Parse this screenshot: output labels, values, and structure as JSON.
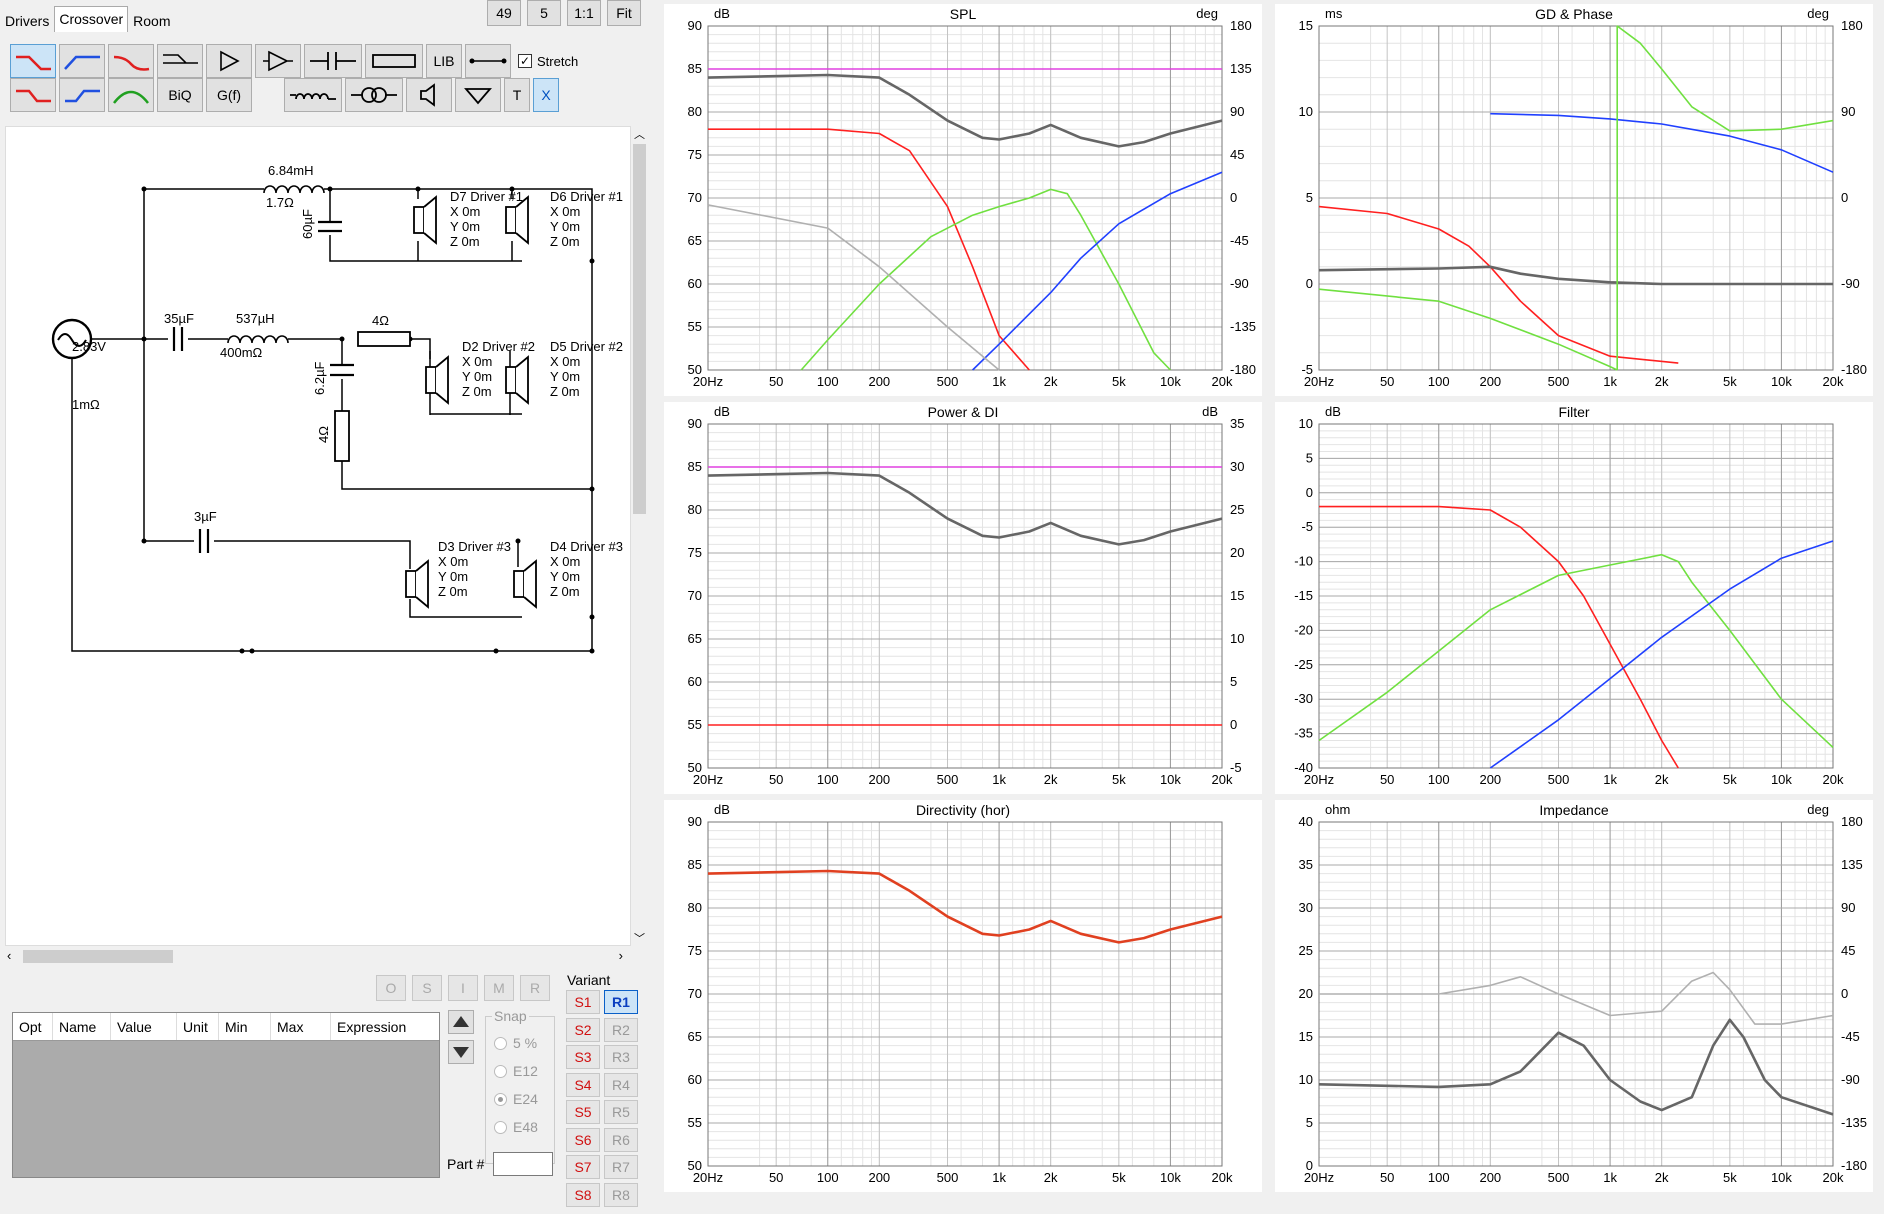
{
  "tabs": [
    {
      "label": "Drivers"
    },
    {
      "label": "Crossover"
    },
    {
      "label": "Room"
    }
  ],
  "top_buttons": {
    "b1": "49",
    "b2": "5",
    "b3": "1:1",
    "b4": "Fit"
  },
  "toolbar": {
    "lib": "LIB",
    "stretch": "Stretch",
    "biq": "BiQ",
    "gf": "G(f)",
    "t": "T",
    "x": "X"
  },
  "schematic": {
    "source_voltage": "2.83V",
    "source_res": "1mΩ",
    "l1": "6.84mH",
    "l1_res": "1.7Ω",
    "c1": "60µF",
    "c2": "35µF",
    "l2": "537µH",
    "l2_res": "400mΩ",
    "r1": "4Ω",
    "c3": "6.2µF",
    "r2": "4Ω",
    "c4": "3µF",
    "drivers": [
      {
        "name": "D7 Driver #1",
        "x": "X 0m",
        "y": "Y 0m",
        "z": "Z 0m"
      },
      {
        "name": "D6 Driver #1",
        "x": "X 0m",
        "y": "Y 0m",
        "z": "Z 0m"
      },
      {
        "name": "D2 Driver #2",
        "x": "X 0m",
        "y": "Y 0m",
        "z": "Z 0m"
      },
      {
        "name": "D5 Driver #2",
        "x": "X 0m",
        "y": "Y 0m",
        "z": "Z 0m"
      },
      {
        "name": "D3 Driver #3",
        "x": "X 0m",
        "y": "Y 0m",
        "z": "Z 0m"
      },
      {
        "name": "D4 Driver #3",
        "x": "X 0m",
        "y": "Y 0m",
        "z": "Z 0m"
      }
    ]
  },
  "optimizer": {
    "buttons": [
      "O",
      "S",
      "I",
      "M",
      "R"
    ],
    "columns": [
      "Opt",
      "Name",
      "Value",
      "Unit",
      "Min",
      "Max",
      "Expression"
    ]
  },
  "snap": {
    "label": "Snap",
    "options": [
      "5 %",
      "E12",
      "E24",
      "E48"
    ],
    "selected": "E24"
  },
  "part_label": "Part #",
  "variant": {
    "label": "Variant",
    "s": [
      "S1",
      "S2",
      "S3",
      "S4",
      "S5",
      "S6",
      "S7",
      "S8"
    ],
    "r": [
      "R1",
      "R2",
      "R3",
      "R4",
      "R5",
      "R6",
      "R7",
      "R8"
    ]
  },
  "colors": {
    "red": "#ff2020",
    "blue": "#2040ff",
    "green": "#70e040",
    "gray": "#666666",
    "lightgray": "#b0b0b0",
    "magenta": "#e040e0",
    "orange": "#e04020"
  },
  "plots": [
    {
      "title": "SPL",
      "lunit": "dB",
      "runit": "deg",
      "ylim": [
        50,
        90
      ],
      "yticks": [
        "90",
        "85",
        "80",
        "75",
        "70",
        "65",
        "60",
        "55",
        "50"
      ],
      "rticks": [
        "180",
        "135",
        "90",
        "45",
        "0",
        "-45",
        "-90",
        "-135",
        "-180"
      ]
    },
    {
      "title": "GD & Phase",
      "lunit": "ms",
      "runit": "deg",
      "ylim": [
        -5,
        15
      ],
      "yticks": [
        "15",
        "10",
        "5",
        "0",
        "-5"
      ],
      "rticks": [
        "180",
        "90",
        "0",
        "-90",
        "-180"
      ]
    },
    {
      "title": "Power & DI",
      "lunit": "dB",
      "runit": "dB",
      "ylim": [
        50,
        90
      ],
      "yticks": [
        "90",
        "85",
        "80",
        "75",
        "70",
        "65",
        "60",
        "55",
        "50"
      ],
      "rticks": [
        "35",
        "30",
        "25",
        "20",
        "15",
        "10",
        "5",
        "0",
        "-5"
      ]
    },
    {
      "title": "Filter",
      "lunit": "dB",
      "runit": "",
      "ylim": [
        -40,
        10
      ],
      "yticks": [
        "10",
        "5",
        "0",
        "-5",
        "-10",
        "-15",
        "-20",
        "-25",
        "-30",
        "-35",
        "-40"
      ],
      "rticks": []
    },
    {
      "title": "Directivity (hor)",
      "lunit": "dB",
      "runit": "",
      "ylim": [
        50,
        90
      ],
      "yticks": [
        "90",
        "85",
        "80",
        "75",
        "70",
        "65",
        "60",
        "55",
        "50"
      ],
      "rticks": []
    },
    {
      "title": "Impedance",
      "lunit": "ohm",
      "runit": "deg",
      "ylim": [
        0,
        40
      ],
      "yticks": [
        "40",
        "35",
        "30",
        "25",
        "20",
        "15",
        "10",
        "5",
        "0"
      ],
      "rticks": [
        "180",
        "135",
        "90",
        "45",
        "0",
        "-45",
        "-90",
        "-135",
        "-180"
      ]
    }
  ],
  "xticks": [
    "20Hz",
    "50",
    "100",
    "200",
    "500",
    "1k",
    "2k",
    "5k",
    "10k",
    "20k"
  ],
  "chart_data": [
    {
      "type": "line",
      "title": "SPL",
      "ylabel": "dB",
      "xlim": [
        20,
        20000
      ],
      "ylim": [
        50,
        90
      ],
      "xscale": "log",
      "series": [
        {
          "color": "magenta",
          "x": [
            20,
            20000
          ],
          "y": [
            85,
            85
          ]
        },
        {
          "color": "gray",
          "x": [
            20,
            100,
            200,
            300,
            500,
            800,
            1000,
            1500,
            2000,
            3000,
            5000,
            7000,
            10000,
            20000
          ],
          "y": [
            84,
            84.3,
            84,
            82,
            79,
            77,
            76.8,
            77.5,
            78.5,
            77,
            76,
            76.5,
            77.5,
            79
          ]
        },
        {
          "color": "red",
          "x": [
            20,
            100,
            200,
            300,
            500,
            700,
            1000,
            1500
          ],
          "y": [
            78,
            78,
            77.5,
            75.5,
            69,
            62,
            54,
            50
          ]
        },
        {
          "color": "green",
          "x": [
            70,
            100,
            200,
            400,
            700,
            1000,
            1500,
            2000,
            2500,
            3000,
            5000,
            8000,
            10000
          ],
          "y": [
            50,
            53.5,
            60,
            65.5,
            68,
            69,
            70,
            71,
            70.5,
            68,
            60,
            52,
            50
          ]
        },
        {
          "color": "blue",
          "x": [
            700,
            1000,
            2000,
            3000,
            5000,
            10000,
            20000
          ],
          "y": [
            50,
            53,
            59,
            63,
            67,
            70.5,
            73
          ]
        },
        {
          "color": "lightgray",
          "x": [
            20,
            100,
            200,
            500,
            1000
          ],
          "y": [
            69.2,
            66.5,
            62,
            55,
            50
          ]
        }
      ]
    },
    {
      "type": "line",
      "title": "GD & Phase",
      "ylabel": "ms",
      "xlim": [
        20,
        20000
      ],
      "ylim": [
        -5,
        15
      ],
      "xscale": "log",
      "series": [
        {
          "color": "red",
          "x": [
            20,
            50,
            100,
            150,
            200,
            300,
            500,
            1000,
            2500
          ],
          "y": [
            4.5,
            4.1,
            3.2,
            2.2,
            1,
            -1,
            -3,
            -4.2,
            -4.6
          ]
        },
        {
          "color": "gray",
          "x": [
            20,
            100,
            200,
            300,
            500,
            1000,
            2000,
            20000
          ],
          "y": [
            0.8,
            0.9,
            1,
            0.6,
            0.3,
            0.1,
            0,
            0
          ]
        },
        {
          "color": "green",
          "x": [
            20,
            100,
            200,
            500,
            1000,
            1100
          ],
          "y": [
            -0.3,
            -1,
            -2,
            -3.5,
            -4.8,
            -5
          ]
        },
        {
          "color": "blue",
          "x": [
            200,
            500,
            1000,
            2000,
            5000,
            10000,
            20000
          ],
          "y": [
            9.9,
            9.8,
            9.6,
            9.3,
            8.6,
            7.8,
            6.5
          ]
        },
        {
          "color": "green",
          "x": [
            1100,
            1100,
            1500,
            2000,
            3000,
            5000,
            10000,
            20000
          ],
          "y": [
            -5,
            15,
            14,
            12.5,
            10.3,
            8.9,
            9,
            9.5
          ]
        }
      ]
    },
    {
      "type": "line",
      "title": "Power & DI",
      "ylabel": "dB",
      "xlim": [
        20,
        20000
      ],
      "ylim": [
        50,
        90
      ],
      "xscale": "log",
      "series": [
        {
          "color": "magenta",
          "x": [
            20,
            20000
          ],
          "y": [
            85,
            85
          ]
        },
        {
          "color": "gray",
          "x": [
            20,
            100,
            200,
            300,
            500,
            800,
            1000,
            1500,
            2000,
            3000,
            5000,
            7000,
            10000,
            20000
          ],
          "y": [
            84,
            84.3,
            84,
            82,
            79,
            77,
            76.8,
            77.5,
            78.5,
            77,
            76,
            76.5,
            77.5,
            79
          ]
        },
        {
          "color": "red",
          "x": [
            20,
            20000
          ],
          "y": [
            55,
            55
          ]
        }
      ]
    },
    {
      "type": "line",
      "title": "Filter",
      "ylabel": "dB",
      "xlim": [
        20,
        20000
      ],
      "ylim": [
        -40,
        10
      ],
      "xscale": "log",
      "series": [
        {
          "color": "red",
          "x": [
            20,
            100,
            200,
            300,
            500,
            700,
            1000,
            1500,
            2000,
            2500
          ],
          "y": [
            -2,
            -2,
            -2.5,
            -5,
            -10,
            -15,
            -22,
            -30,
            -36,
            -40
          ]
        },
        {
          "color": "green",
          "x": [
            20,
            50,
            100,
            200,
            500,
            1000,
            2000,
            2500,
            3000,
            5000,
            10000,
            20000
          ],
          "y": [
            -36,
            -29,
            -23,
            -17,
            -12,
            -10.5,
            -9,
            -10,
            -13,
            -20,
            -30,
            -37
          ]
        },
        {
          "color": "blue",
          "x": [
            200,
            500,
            1000,
            2000,
            5000,
            10000,
            20000
          ],
          "y": [
            -40,
            -33,
            -27,
            -21,
            -14,
            -9.5,
            -7
          ]
        }
      ]
    },
    {
      "type": "line",
      "title": "Directivity (hor)",
      "ylabel": "dB",
      "xlim": [
        20,
        20000
      ],
      "ylim": [
        50,
        90
      ],
      "xscale": "log",
      "series": [
        {
          "color": "orange",
          "x": [
            20,
            100,
            200,
            300,
            500,
            800,
            1000,
            1500,
            2000,
            3000,
            5000,
            7000,
            10000,
            20000
          ],
          "y": [
            84,
            84.3,
            84,
            82,
            79,
            77,
            76.8,
            77.5,
            78.5,
            77,
            76,
            76.5,
            77.5,
            79
          ]
        }
      ]
    },
    {
      "type": "line",
      "title": "Impedance",
      "ylabel": "ohm",
      "xlim": [
        20,
        20000
      ],
      "ylim": [
        0,
        40
      ],
      "xscale": "log",
      "series": [
        {
          "color": "lightgray",
          "x": [
            20,
            100,
            200,
            300,
            500,
            1000,
            2000,
            3000,
            4000,
            5000,
            7000,
            10000,
            20000
          ],
          "y": [
            20,
            20,
            21,
            22,
            20,
            17.5,
            18,
            21.5,
            22.5,
            20.5,
            16.5,
            16.5,
            17.5
          ]
        },
        {
          "color": "gray",
          "x": [
            20,
            100,
            200,
            300,
            500,
            700,
            1000,
            1500,
            2000,
            3000,
            4000,
            5000,
            6000,
            8000,
            10000,
            20000
          ],
          "y": [
            9.5,
            9.2,
            9.5,
            11,
            15.5,
            14,
            10,
            7.5,
            6.5,
            8,
            14,
            17,
            15,
            10,
            8,
            6
          ]
        }
      ]
    }
  ]
}
